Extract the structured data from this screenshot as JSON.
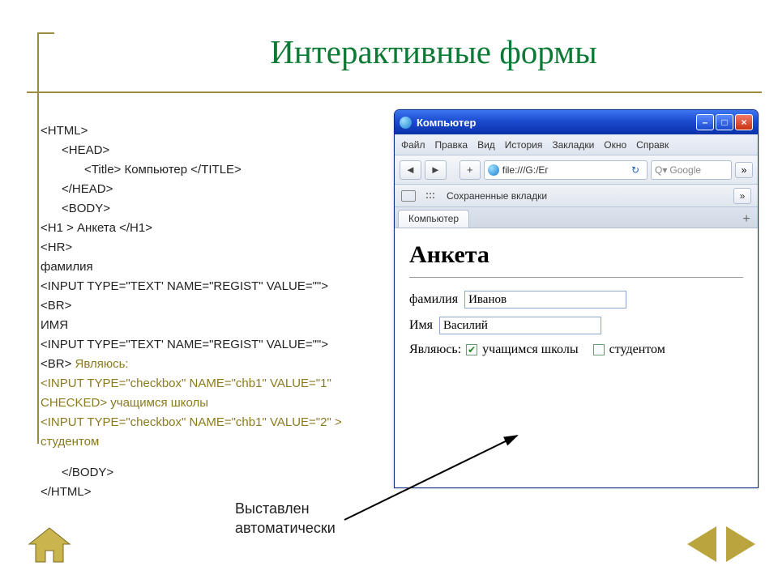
{
  "title": "Интерактивные формы",
  "code": {
    "l1": "<HTML>",
    "l2": "<HEAD>",
    "l3": "<Title> Компьютер </TITLE>",
    "l4": "</HEAD>",
    "l5": "<BODY>",
    "l6": "<H1 > Анкета </H1>",
    "l7": "<HR>",
    "l8": "фамилия",
    "l9": "<INPUT TYPE=\"TEXT' NAME=\"REGIST\" VALUE=\"\">",
    "l10": "<BR>",
    "l11": "ИМЯ",
    "l12": "<INPUT TYPE=\"TEXT' NAME=\"REGIST\" VALUE=\"\">",
    "l13_a": "<BR>",
    "l13_b": " Являюсь:",
    "l14": "<INPUT TYPE=\"checkbox\" NAME=\"chb1\" VALUE=\"1\" CHECKED>",
    "l14_b": " учащимся школы",
    "l15": "<INPUT TYPE=\"checkbox\" NAME=\"chb1\" VALUE=\"2\" >",
    "l15_b": " студентом",
    "l16": "</BODY>",
    "l17": "</HTML>"
  },
  "browser": {
    "window_title": "Компьютер",
    "menu": [
      "Файл",
      "Правка",
      "Вид",
      "История",
      "Закладки",
      "Окно",
      "Справк"
    ],
    "url": "file:///G:/Ег",
    "search_placeholder": "Google",
    "bookmarks_label": "Сохраненные вкладки",
    "tab_label": "Компьютер",
    "page": {
      "heading": "Анкета",
      "surname_label": "фамилия",
      "surname_value": "Иванов",
      "name_label": "Имя",
      "name_value": "Василий",
      "iam_label": "Являюсь:",
      "opt1": "учащимся школы",
      "opt2": "студентом"
    }
  },
  "caption_line1": "Выставлен",
  "caption_line2": "автоматически"
}
